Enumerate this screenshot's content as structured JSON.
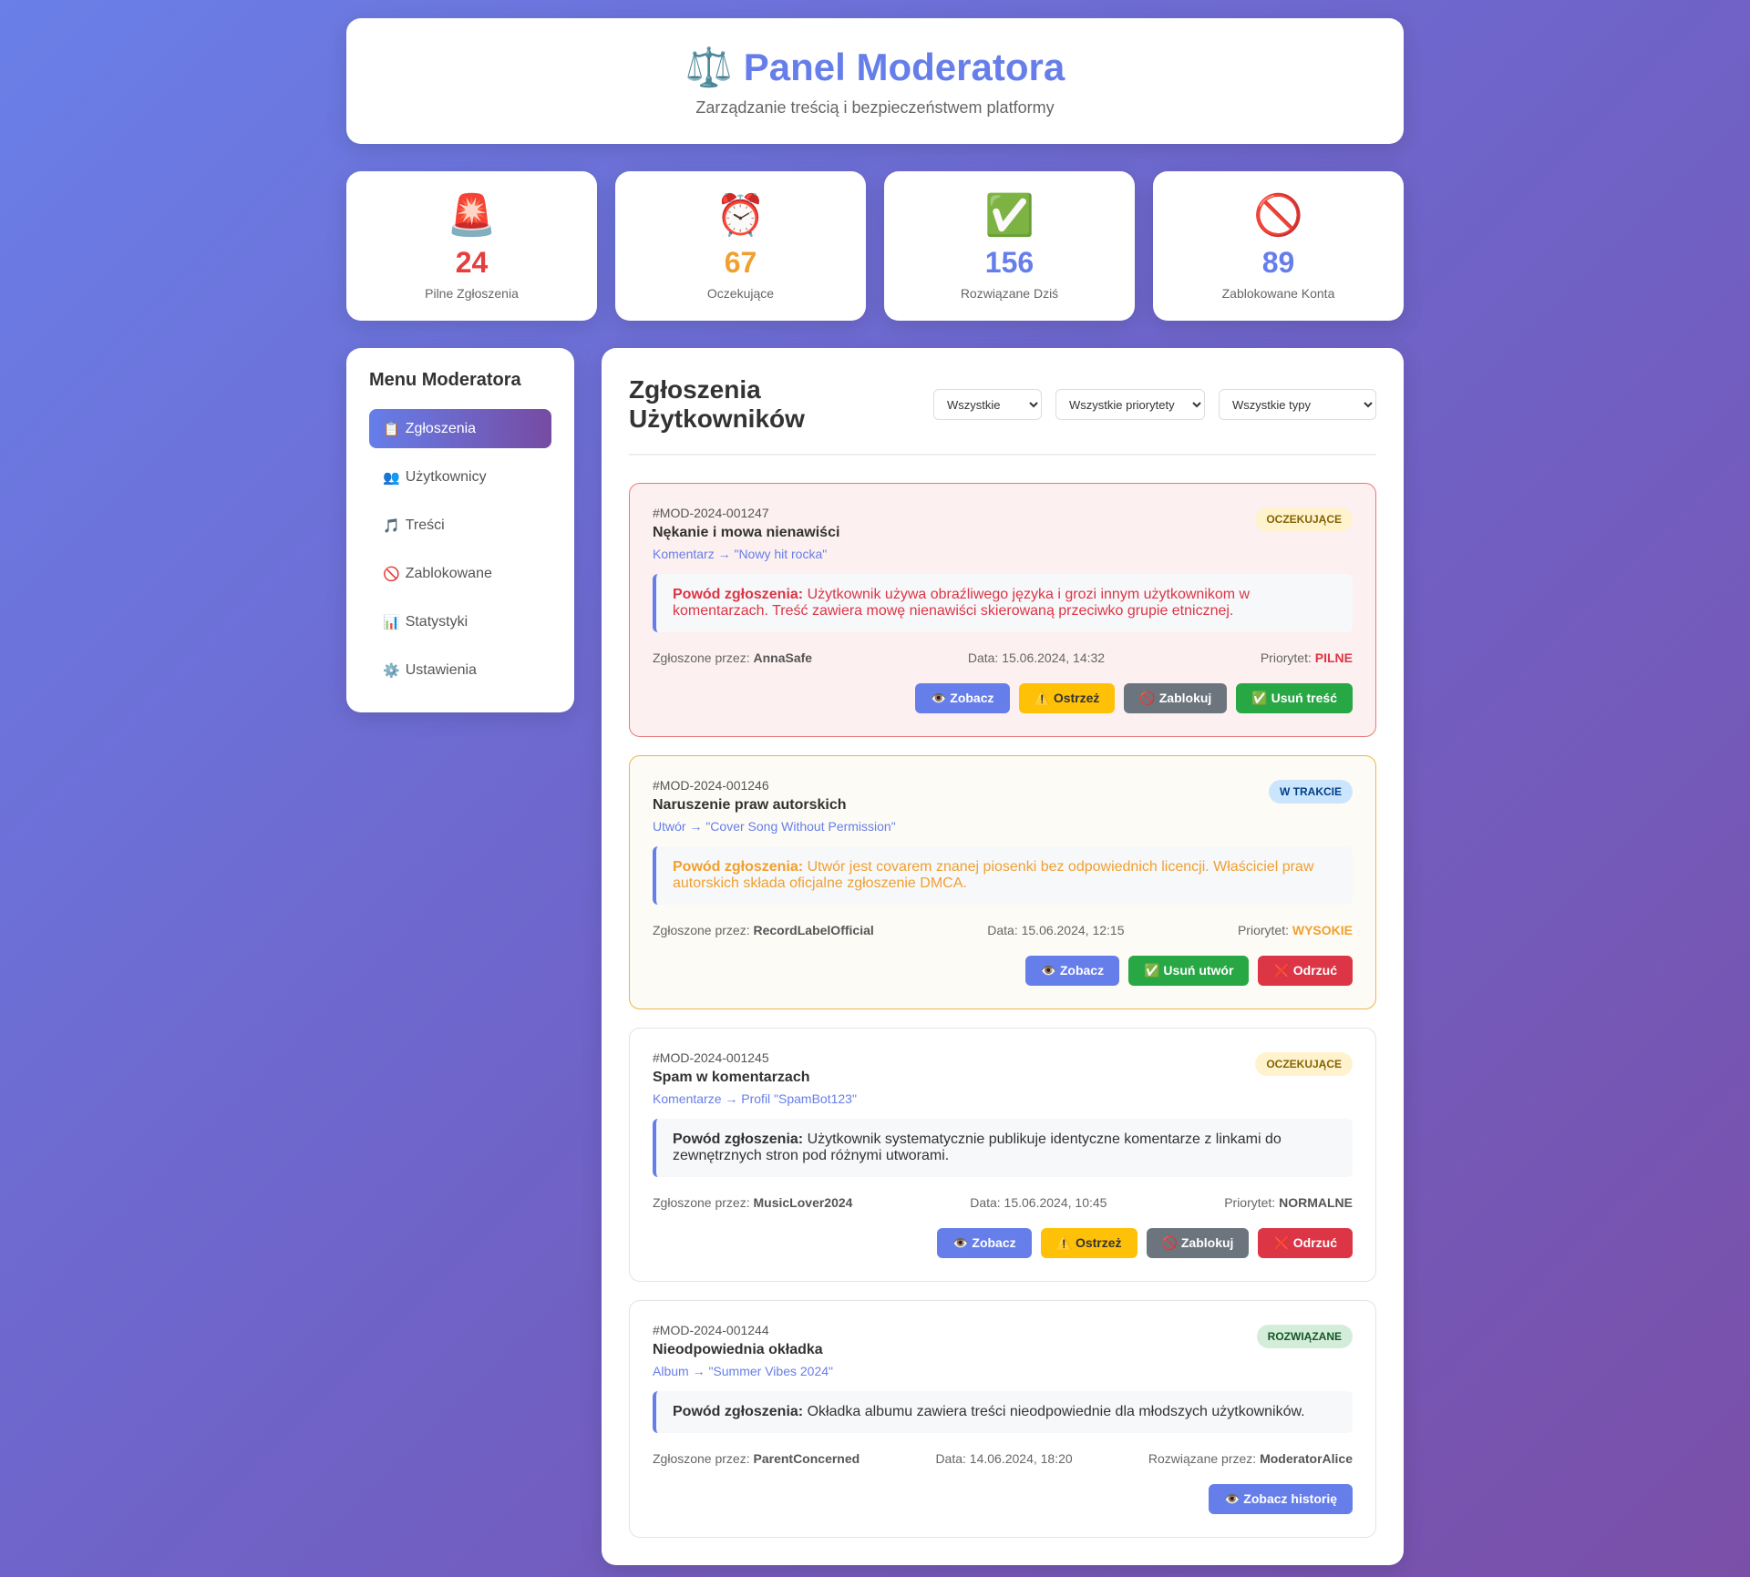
{
  "header": {
    "icon": "⚖️",
    "title": "Panel Moderatora",
    "subtitle": "Zarządzanie treścią i bezpieczeństwem platformy"
  },
  "stats": [
    {
      "icon": "🚨",
      "value": "24",
      "label": "Pilne Zgłoszenia",
      "color": "#e53e3e"
    },
    {
      "icon": "⏰",
      "value": "67",
      "label": "Oczekujące",
      "color": "#f0a030"
    },
    {
      "icon": "✅",
      "value": "156",
      "label": "Rozwiązane Dziś",
      "color": "#667eea"
    },
    {
      "icon": "🚫",
      "value": "89",
      "label": "Zablokowane Konta",
      "color": "#667eea"
    }
  ],
  "sidebar": {
    "title": "Menu Moderatora",
    "items": [
      {
        "icon": "📋",
        "label": "Zgłoszenia"
      },
      {
        "icon": "👥",
        "label": "Użytkownicy"
      },
      {
        "icon": "🎵",
        "label": "Treści"
      },
      {
        "icon": "🚫",
        "label": "Zablokowane"
      },
      {
        "icon": "📊",
        "label": "Statystyki"
      },
      {
        "icon": "⚙️",
        "label": "Ustawienia"
      }
    ]
  },
  "content": {
    "title": "Zgłoszenia Użytkowników",
    "filters": {
      "status": "Wszystkie",
      "priority": "Wszystkie priorytety",
      "type": "Wszystkie typy"
    }
  },
  "reports": [
    {
      "id": "#MOD-2024-001247",
      "title": "Nękanie i mowa nienawiści",
      "target": "Komentarz → \"Nowy hit rocka\"",
      "status": "OCZEKUJĄCE",
      "reason_label": "Powód zgłoszenia:",
      "reason": "Użytkownik używa obraźliwego języka i grozi innym użytkownikom w komentarzach. Treść zawiera mowę nienawiści skierowaną przeciwko grupie etnicznej.",
      "reporter_label": "Zgłoszone przez:",
      "reporter": "AnnaSafe",
      "date": "Data: 15.06.2024, 14:32",
      "extra_label": "Priorytet:",
      "extra_value": "PILNE",
      "actions": [
        "👁️ Zobacz",
        "⚠️ Ostrzeż",
        "🚫 Zablokuj",
        "✅ Usuń treść"
      ]
    },
    {
      "id": "#MOD-2024-001246",
      "title": "Naruszenie praw autorskich",
      "target": "Utwór → \"Cover Song Without Permission\"",
      "status": "W TRAKCIE",
      "reason_label": "Powód zgłoszenia:",
      "reason": "Utwór jest covarem znanej piosenki bez odpowiednich licencji. Właściciel praw autorskich składa oficjalne zgłoszenie DMCA.",
      "reporter_label": "Zgłoszone przez:",
      "reporter": "RecordLabelOfficial",
      "date": "Data: 15.06.2024, 12:15",
      "extra_label": "Priorytet:",
      "extra_value": "WYSOKIE",
      "actions": [
        "👁️ Zobacz",
        "✅ Usuń utwór",
        "❌ Odrzuć"
      ]
    },
    {
      "id": "#MOD-2024-001245",
      "title": "Spam w komentarzach",
      "target": "Komentarze → Profil \"SpamBot123\"",
      "status": "OCZEKUJĄCE",
      "reason_label": "Powód zgłoszenia:",
      "reason": "Użytkownik systematycznie publikuje identyczne komentarze z linkami do zewnętrznych stron pod różnymi utworami.",
      "reporter_label": "Zgłoszone przez:",
      "reporter": "MusicLover2024",
      "date": "Data: 15.06.2024, 10:45",
      "extra_label": "Priorytet:",
      "extra_value": "NORMALNE",
      "actions": [
        "👁️ Zobacz",
        "⚠️ Ostrzeż",
        "🚫 Zablokuj",
        "❌ Odrzuć"
      ]
    },
    {
      "id": "#MOD-2024-001244",
      "title": "Nieodpowiednia okładka",
      "target": "Album → \"Summer Vibes 2024\"",
      "status": "ROZWIĄZANE",
      "reason_label": "Powód zgłoszenia:",
      "reason": "Okładka albumu zawiera treści nieodpowiednie dla młodszych użytkowników.",
      "reporter_label": "Zgłoszone przez:",
      "reporter": "ParentConcerned",
      "date": "Data: 14.06.2024, 18:20",
      "extra_label": "Rozwiązane przez:",
      "extra_value": "ModeratorAlice",
      "actions": [
        "👁️ Zobacz historię"
      ]
    }
  ]
}
